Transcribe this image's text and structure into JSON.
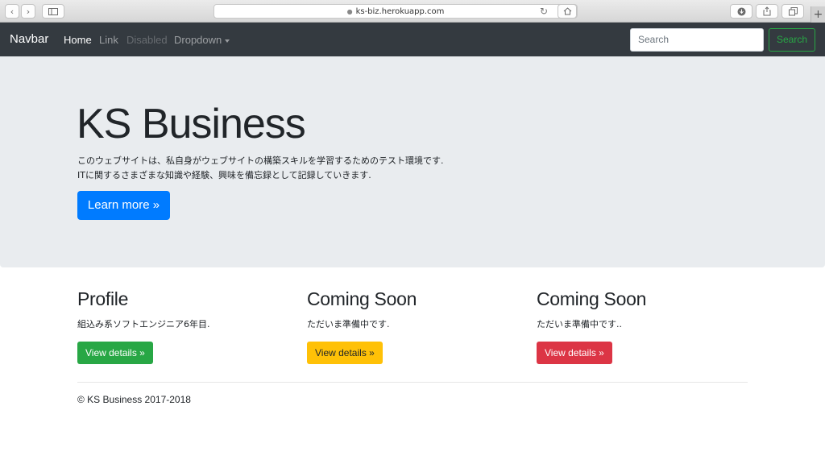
{
  "browser": {
    "url": "ks-biz.herokuapp.com"
  },
  "navbar": {
    "brand": "Navbar",
    "links": {
      "home": "Home",
      "link": "Link",
      "disabled": "Disabled",
      "dropdown": "Dropdown"
    },
    "search": {
      "placeholder": "Search",
      "button_label": "Search"
    },
    "colors": {
      "background": "#343a40",
      "search_button": "#28a745"
    }
  },
  "jumbotron": {
    "title": "KS Business",
    "text_line1": "このウェブサイトは、私自身がウェブサイトの構築スキルを学習するためのテスト環境です.",
    "text_line2": "ITに関するさまざまな知識や経験、興味を備忘録として記録していきます.",
    "button_label": "Learn more »",
    "colors": {
      "background": "#e9ecef",
      "button": "#007bff"
    }
  },
  "columns": [
    {
      "heading": "Profile",
      "text": "組込み系ソフトエンジニア6年目.",
      "button_label": "View details »",
      "button_color": "#28a745"
    },
    {
      "heading": "Coming Soon",
      "text": "ただいま準備中です.",
      "button_label": "View details »",
      "button_color": "#ffc107"
    },
    {
      "heading": "Coming Soon",
      "text": "ただいま準備中です..",
      "button_label": "View details »",
      "button_color": "#dc3545"
    }
  ],
  "footer": {
    "text": "© KS Business 2017-2018"
  }
}
